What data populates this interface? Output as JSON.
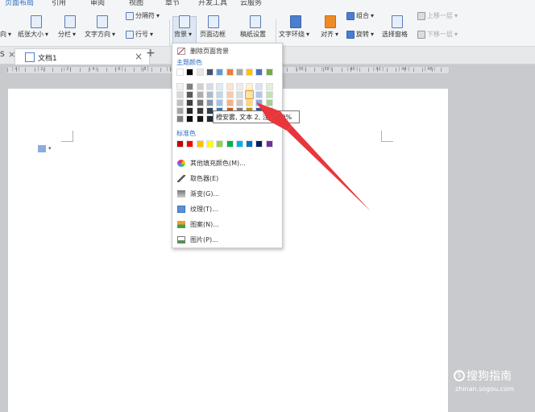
{
  "menu_tabs": [
    "页面布局",
    "引用",
    "审阅",
    "视图",
    "章节",
    "开发工具",
    "云服务"
  ],
  "toolbar": {
    "orientation": "向",
    "paper_size": "纸张大小",
    "columns": "分栏",
    "text_direction": "文字方向",
    "separator": "分隔符",
    "line_number": "行号",
    "background": "背景",
    "page_border": "页面边框",
    "paper_settings": "稿纸设置",
    "text_wrap": "文字环绕",
    "align": "对齐",
    "group": "组合",
    "rotate": "旋转",
    "selection_pane": "选择窗格",
    "bring_forward": "上移一层",
    "send_backward": "下移一层"
  },
  "doc_tab": {
    "prev_label": "S",
    "title": "文档1"
  },
  "ruler_labels": [
    "| 4 |",
    "| 2 |",
    "| 2 |",
    "| 4 |",
    "| 6 |",
    "| 8 |",
    "| 10 |",
    "| 28 |",
    "| 30 |",
    "| 32 |",
    "| 34 |",
    "| 36 |",
    "| 38 |",
    "| 40 |",
    "| 42 |",
    "| 44 |",
    "| 46 |"
  ],
  "background_menu": {
    "delete_bg": "删除页面背景",
    "theme_colors_title": "主题颜色",
    "standard_colors_title": "标准色",
    "more_colors": "其他填充颜色(M)...",
    "eyedropper": "取色器(E)",
    "gradient": "渐变(G)...",
    "texture": "纹理(T)...",
    "pattern": "图案(N)...",
    "picture": "图片(P)..."
  },
  "theme_colors_top": [
    "#ffffff",
    "#000000",
    "#e7e6e6",
    "#44546a",
    "#5b9bd5",
    "#ed7d31",
    "#a5a5a5",
    "#ffc000",
    "#4472c4",
    "#70ad47"
  ],
  "theme_colors_rows": [
    [
      "#f2f2f2",
      "#7f7f7f",
      "#d0cece",
      "#d6dce4",
      "#deebf6",
      "#fbe5d5",
      "#ededed",
      "#fff2cc",
      "#dae3f3",
      "#e2efd9"
    ],
    [
      "#d8d8d8",
      "#595959",
      "#aeabab",
      "#adb9ca",
      "#bdd7ee",
      "#f8cbad",
      "#dbdbdb",
      "#fee599",
      "#b4c6e7",
      "#c5e0b3"
    ],
    [
      "#bfbfbf",
      "#3f3f3f",
      "#757070",
      "#8496b0",
      "#9dc3e6",
      "#f4b183",
      "#c9c9c9",
      "#ffd965",
      "#8eaadb",
      "#a8d08d"
    ],
    [
      "#a5a5a5",
      "#262626",
      "#3a3838",
      "#323f4f",
      "#2e75b5",
      "#c55a11",
      "#7b7b7b",
      "#bf9000",
      "#2f5496",
      "#538135"
    ],
    [
      "#7f7f7f",
      "#0c0c0c",
      "#171616",
      "#222a35",
      "#1e4e79",
      "#833c0b",
      "#525252",
      "#7f6000",
      "#1f3864",
      "#375623"
    ]
  ],
  "standard_colors": [
    "#c00000",
    "#ff0000",
    "#ffc000",
    "#ffff00",
    "#92d050",
    "#00b050",
    "#00b0f0",
    "#0070c0",
    "#002060",
    "#7030a0"
  ],
  "tooltip": "橙安雾, 文本 2, 浅色 60%",
  "watermark": {
    "title": "搜狗指南",
    "url": "zhinan.sogou.com"
  },
  "colors": {
    "accent": "#2b6cc4",
    "arrow": "#e8373c"
  }
}
